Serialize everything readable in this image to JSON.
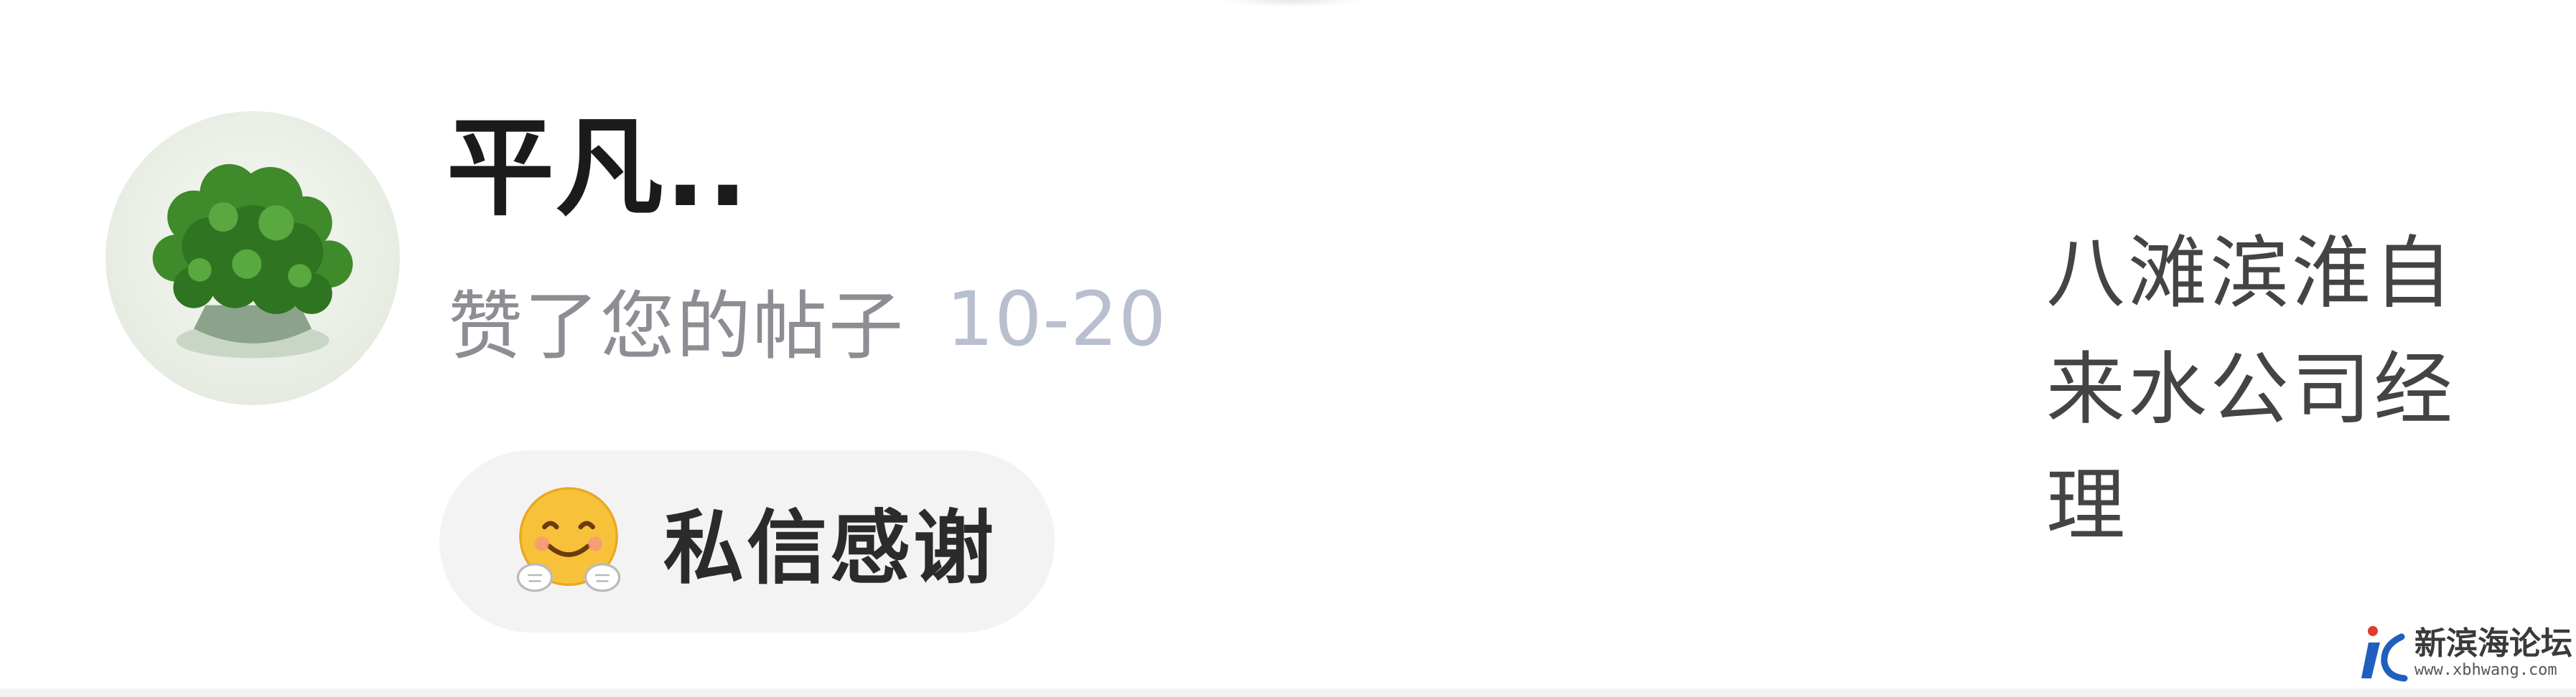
{
  "notification": {
    "username": "平凡..",
    "action": "赞了您的帖子",
    "date": "10-20",
    "thank_button": {
      "label": "私信感谢",
      "icon": "hug-emoji-icon"
    },
    "post_snippet": "八滩滨淮自来水公司经理"
  },
  "watermark": {
    "title": "新滨海论坛",
    "url": "www.xbhwang.com"
  },
  "colors": {
    "username": "#1b1b1b",
    "action_text": "#8d8d93",
    "date_text": "#b8bfcf",
    "button_bg": "#f3f3f4",
    "snippet_text": "#444444"
  }
}
